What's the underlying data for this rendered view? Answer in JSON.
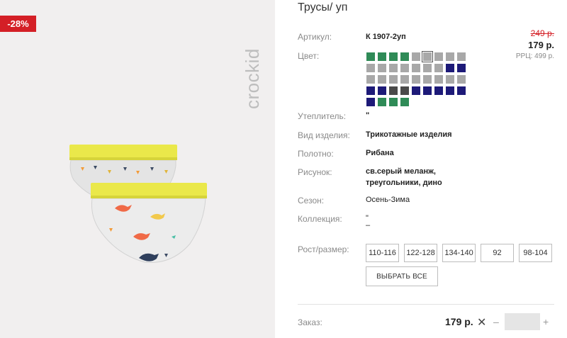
{
  "product": {
    "title": "Трусы/ уп",
    "discount": "-28%",
    "brand": "crockid"
  },
  "price": {
    "old": "249 р.",
    "current": "179 р.",
    "rrp": "РРЦ: 499 р."
  },
  "attributes": {
    "article_label": "Артикул:",
    "article_value": "К 1907-2уп",
    "color_label": "Цвет:",
    "insulation_label": "Утеплитель:",
    "insulation_value": "\"",
    "type_label": "Вид изделия:",
    "type_value": "Трикотажные изделия",
    "fabric_label": "Полотно:",
    "fabric_value": "Рибана",
    "pattern_label": "Рисунок:",
    "pattern_value_1": "св.серый меланж,",
    "pattern_value_2": "треугольники, дино",
    "season_label": "Сезон:",
    "season_value": "Осень-Зима",
    "collection_label": "Коллекция:",
    "collection_value_1": "\"",
    "collection_value_2": "–"
  },
  "colors": {
    "swatches": [
      [
        "#2f8b57",
        "#2f8b57",
        "#2f8b57",
        "#2f8b57",
        "#a8a8a8",
        "#a8a8a8",
        "#a8a8a8",
        "#a8a8a8",
        "#a8a8a8"
      ],
      [
        "#a8a8a8",
        "#a8a8a8",
        "#a8a8a8",
        "#a8a8a8",
        "#a8a8a8",
        "#a8a8a8",
        "#a8a8a8",
        "#1d1a78",
        "#1d1a78"
      ],
      [
        "#a8a8a8",
        "#a8a8a8",
        "#a8a8a8",
        "#a8a8a8",
        "#a8a8a8",
        "#a8a8a8",
        "#a8a8a8",
        "#a8a8a8",
        "#a8a8a8"
      ],
      [
        "#1d1a78",
        "#1d1a78",
        "#4a4a4a",
        "#4a4a4a",
        "#1d1a78",
        "#1d1a78",
        "#1d1a78",
        "#1d1a78",
        "#1d1a78"
      ],
      [
        "#1d1a78",
        "#2f8b57",
        "#2f8b57",
        "#2f8b57"
      ]
    ],
    "selected": [
      0,
      5
    ]
  },
  "sizes": {
    "label": "Рост/размер:",
    "options": [
      "110-116",
      "122-128",
      "134-140",
      "92",
      "98-104"
    ],
    "select_all": "ВЫБРАТЬ ВСЕ"
  },
  "order": {
    "label": "Заказ:",
    "price": "179 р.",
    "remove": "✕",
    "minus": "–",
    "plus": "+",
    "quantity": ""
  }
}
